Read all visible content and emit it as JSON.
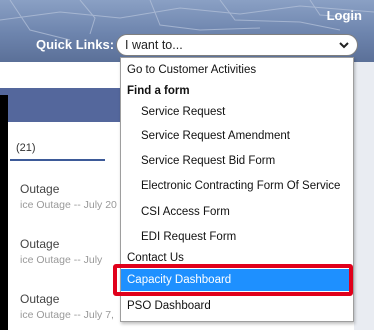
{
  "header": {
    "login_label": "Login",
    "quick_links_label": "Quick Links:",
    "select_value": "I want to...",
    "chevron_icon": "chevron-down-icon"
  },
  "background": {
    "tab_count": "(21)",
    "feed": [
      {
        "title": "Outage",
        "subtitle": "ice Outage -- July 20"
      },
      {
        "title": "Outage",
        "subtitle": "ice Outage -- July"
      },
      {
        "title": "Outage",
        "subtitle": "ice Outage -- July 7,"
      }
    ]
  },
  "dropdown": {
    "options": [
      {
        "label": "Go to Customer Activities"
      },
      {
        "label": "Find a form",
        "group": true
      },
      {
        "label": "Service Request"
      },
      {
        "label": "Service Request Amendment"
      },
      {
        "label": "Service Request Bid Form"
      },
      {
        "label": "Electronic Contracting Form Of Service"
      },
      {
        "label": "CSI Access Form"
      },
      {
        "label": "EDI Request Form"
      },
      {
        "label": "Contact Us"
      },
      {
        "label": "Capacity Dashboard",
        "selected": true
      },
      {
        "label": "PSO Dashboard"
      }
    ]
  },
  "colors": {
    "header_blue": "#6d84ad",
    "selection_blue": "#1e90ff",
    "highlight_red": "#e0001b"
  }
}
